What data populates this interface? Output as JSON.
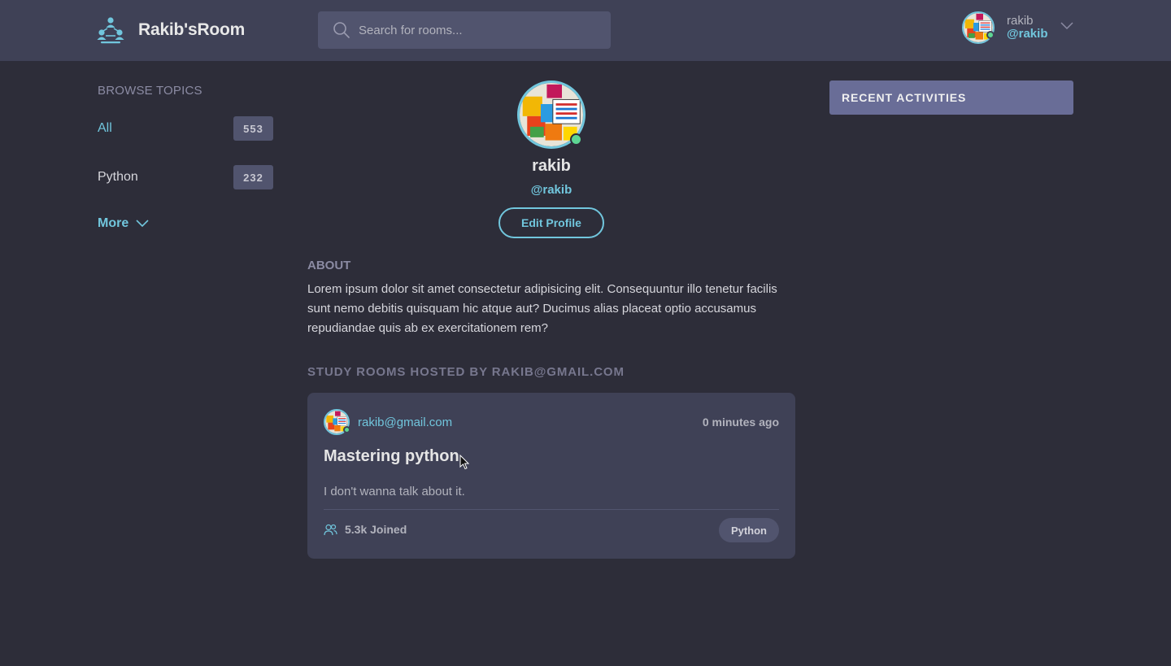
{
  "app": {
    "name": "Rakib'sRoom",
    "logo_icon": "network-people-icon"
  },
  "search": {
    "placeholder": "Search for rooms..."
  },
  "current_user": {
    "name": "rakib",
    "handle": "@rakib",
    "online": true
  },
  "sidebar": {
    "heading": "BROWSE TOPICS",
    "topics": [
      {
        "label": "All",
        "count": "553",
        "active": true
      },
      {
        "label": "Python",
        "count": "232",
        "active": false
      }
    ],
    "more_label": "More"
  },
  "profile": {
    "name": "rakib",
    "handle": "@rakib",
    "edit_label": "Edit Profile",
    "about_heading": "ABOUT",
    "about_text": "Lorem ipsum dolor sit amet consectetur adipisicing elit. Consequuntur illo tenetur facilis sunt nemo debitis quisquam hic atque aut? Ducimus alias placeat optio accusamus repudiandae quis ab ex exercitationem rem?"
  },
  "rooms": {
    "heading": "STUDY ROOMS HOSTED BY RAKIB@GMAIL.COM",
    "items": [
      {
        "host": "rakib@gmail.com",
        "time": "0 minutes ago",
        "title": "Mastering python",
        "description": "I don't wanna talk about it.",
        "joined": "5.3k Joined",
        "topic": "Python"
      }
    ]
  },
  "activities": {
    "heading": "RECENT ACTIVITIES"
  },
  "colors": {
    "background": "#2d2d39",
    "header": "#3f4156",
    "accent": "#71c6dd",
    "online": "#5dd693",
    "activities_bar": "#696d97"
  }
}
